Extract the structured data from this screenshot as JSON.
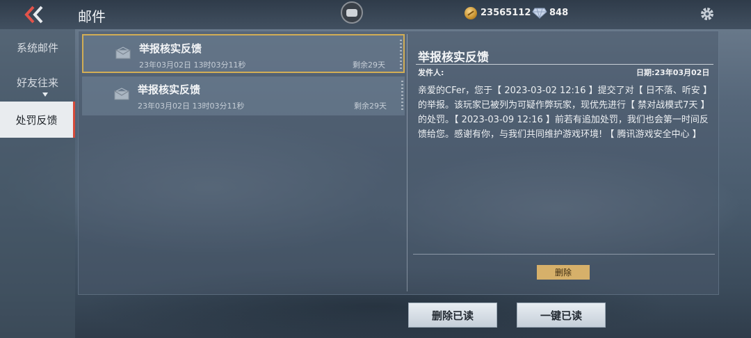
{
  "header": {
    "title": "邮件",
    "coins": "23565112",
    "diamonds": "848"
  },
  "sidebar": {
    "items": [
      {
        "label": "系统邮件"
      },
      {
        "label": "好友往来"
      },
      {
        "label": "处罚反馈",
        "active": true
      }
    ]
  },
  "mails": [
    {
      "title": "举报核实反馈",
      "date": "23年03月02日 13时03分11秒",
      "remain": "剩余29天",
      "selected": true
    },
    {
      "title": "举报核实反馈",
      "date": "23年03月02日 13时03分11秒",
      "remain": "剩余29天",
      "selected": false
    }
  ],
  "detail": {
    "title": "举报核实反馈",
    "sender_label": "发件人:",
    "date_label": "日期:23年03月02日",
    "body": "亲爱的CFer，您于【 2023-03-02 12:16 】提交了对【 日不落、听安 】的举报。该玩家已被列为可疑作弊玩家，现优先进行【 禁对战模式7天 】的处罚。【 2023-03-09 12:16 】前若有追加处罚，我们也会第一时间反馈给您。感谢有你，与我们共同维护游戏环境! 【 腾讯游戏安全中心 】",
    "delete_label": "删除"
  },
  "footer": {
    "delete_read_label": "删除已读",
    "mark_all_read_label": "一键已读"
  },
  "colors": {
    "accent_gold": "#d6b06a",
    "active_tab_marker": "#d64a3a"
  },
  "icons": [
    "back-arrow-icon",
    "chat-icon",
    "coin-icon",
    "diamond-icon",
    "gear-icon",
    "envelope-icon"
  ]
}
